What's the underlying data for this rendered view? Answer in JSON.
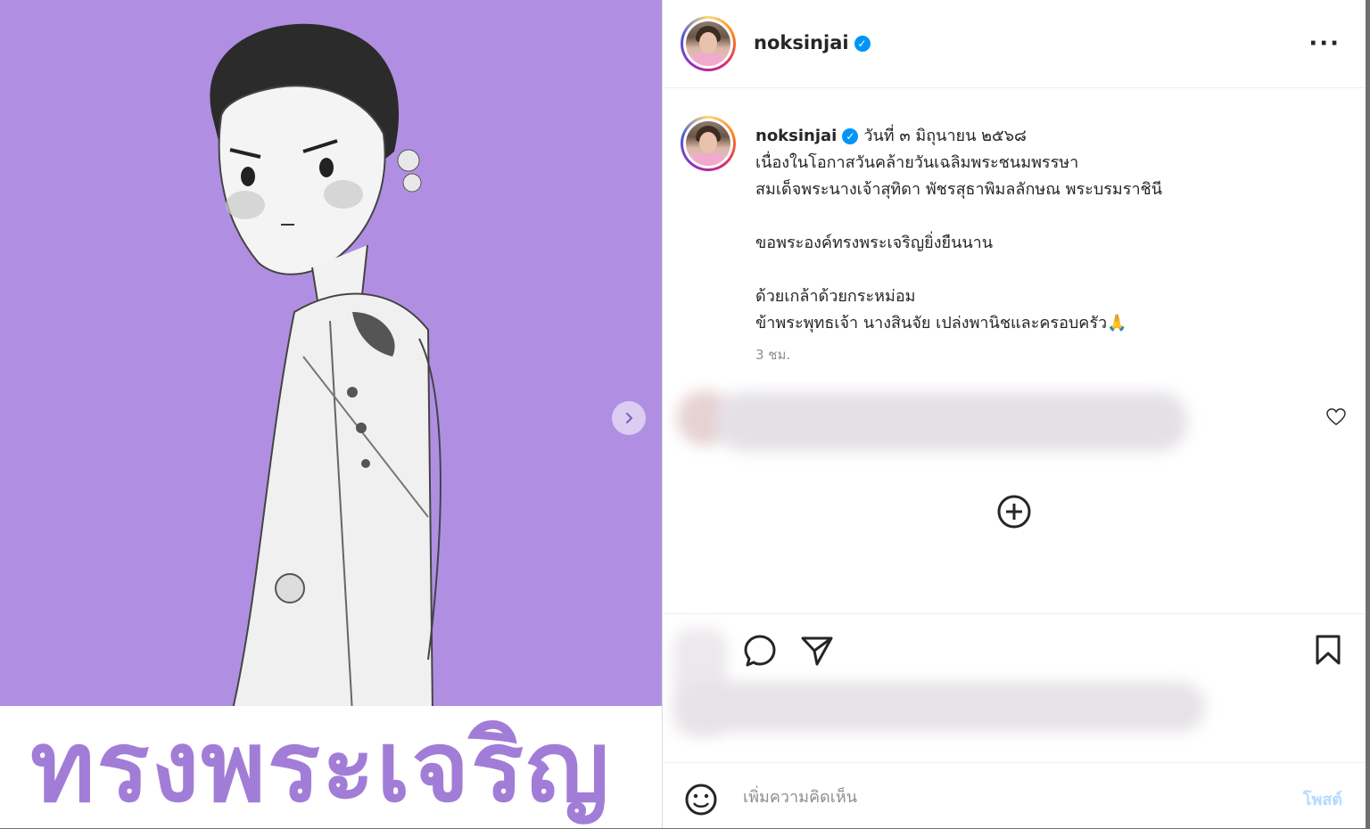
{
  "media": {
    "overlay_text": "ทรงพระเจริญ",
    "background_color": "#b08fe3",
    "text_color": "#a27dd7"
  },
  "header": {
    "username": "noksinjai",
    "verified_icon": "verified-badge-icon",
    "more_icon": "more-options-icon"
  },
  "caption": {
    "username": "noksinjai",
    "date": "วันที่ ๓ มิถุนายน ๒๕๖๘",
    "lines": [
      "เนื่องในโอกาสวันคล้ายวันเฉลิมพระชนมพรรษา",
      "สมเด็จพระนางเจ้าสุทิดา พัชรสุธาพิมลลักษณ พระบรมราชินี",
      "ขอพระองค์ทรงพระเจริญยิ่งยืนนาน",
      "ด้วยเกล้าด้วยกระหม่อม",
      "ข้าพระพุทธเจ้า นางสินจัย เปล่งพานิชและครอบครัว🙏"
    ],
    "time": "3 ชม."
  },
  "comment": {
    "placeholder": "เพิ่มความคิดเห็น",
    "post_label": "โพสต์"
  },
  "colors": {
    "verified": "#0095f6",
    "post_button": "#b3dbff"
  }
}
